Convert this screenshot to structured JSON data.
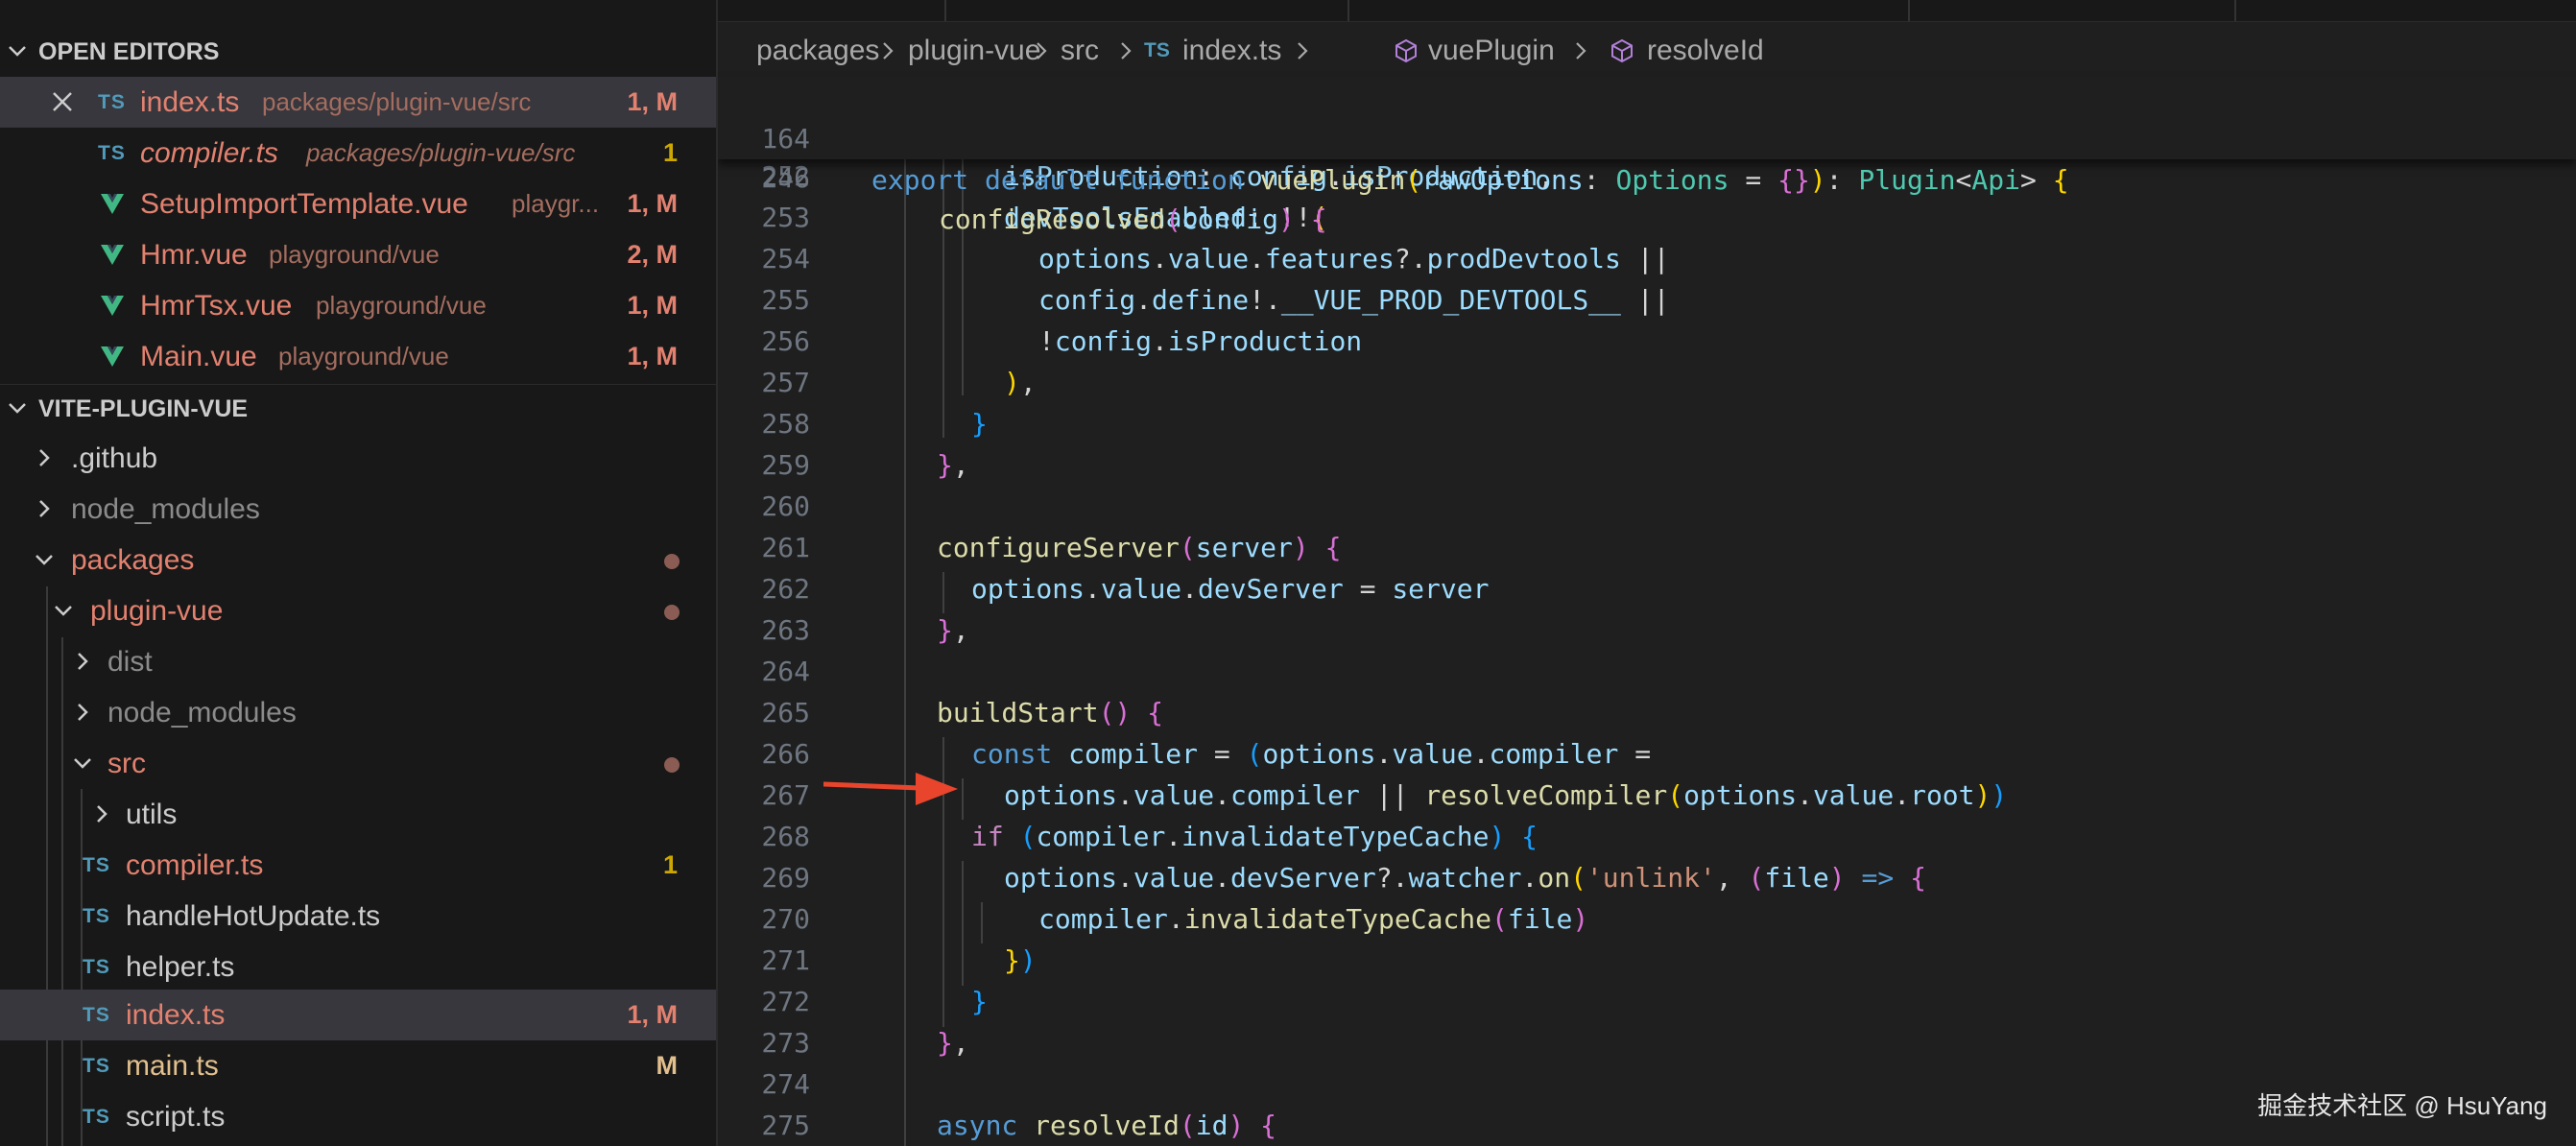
{
  "explorer": {
    "open_editors_title": "OPEN EDITORS",
    "project_title": "VITE-PLUGIN-VUE",
    "ts_badge": "TS",
    "open_editors": [
      {
        "name": "index.ts",
        "path": "packages/plugin-vue/src",
        "status": "1, M",
        "type": "ts"
      },
      {
        "name": "compiler.ts",
        "path": "packages/plugin-vue/src",
        "status": "1",
        "type": "ts"
      },
      {
        "name": "SetupImportTemplate.vue",
        "path": "playgr...",
        "status": "1, M",
        "type": "vue"
      },
      {
        "name": "Hmr.vue",
        "path": "playground/vue",
        "status": "2, M",
        "type": "vue"
      },
      {
        "name": "HmrTsx.vue",
        "path": "playground/vue",
        "status": "1, M",
        "type": "vue"
      },
      {
        "name": "Main.vue",
        "path": "playground/vue",
        "status": "1, M",
        "type": "vue"
      }
    ],
    "tree": [
      {
        "name": ".github"
      },
      {
        "name": "node_modules"
      },
      {
        "name": "packages"
      },
      {
        "name": "plugin-vue"
      },
      {
        "name": "dist"
      },
      {
        "name": "node_modules"
      },
      {
        "name": "src"
      },
      {
        "name": "utils"
      },
      {
        "name": "compiler.ts",
        "status": "1"
      },
      {
        "name": "handleHotUpdate.ts"
      },
      {
        "name": "helper.ts"
      },
      {
        "name": "index.ts",
        "status": "1, M"
      },
      {
        "name": "main.ts",
        "status": "M"
      },
      {
        "name": "script.ts"
      }
    ]
  },
  "breadcrumb": {
    "items": [
      "packages",
      "plugin-vue",
      "src",
      "index.ts",
      "vuePlugin",
      "resolveId"
    ],
    "ts_badge": "TS"
  },
  "editor": {
    "sticky_lines": [
      {
        "num": "164",
        "text": "export default function vuePlugin(rawOptions: Options = {}): Plugin<Api> {"
      },
      {
        "num": "246",
        "text": "configResolved(config) {"
      }
    ],
    "lines": [
      {
        "num": "252",
        "text": "isProduction: config.isProduction,"
      },
      {
        "num": "253",
        "text": "devToolsEnabled: !!("
      },
      {
        "num": "254",
        "text": "options.value.features?.prodDevtools ||"
      },
      {
        "num": "255",
        "text": "config.define!.__VUE_PROD_DEVTOOLS__ ||"
      },
      {
        "num": "256",
        "text": "!config.isProduction"
      },
      {
        "num": "257",
        "text": "),"
      },
      {
        "num": "258",
        "text": "}"
      },
      {
        "num": "259",
        "text": "},"
      },
      {
        "num": "260",
        "text": ""
      },
      {
        "num": "261",
        "text": "configureServer(server) {"
      },
      {
        "num": "262",
        "text": "options.value.devServer = server"
      },
      {
        "num": "263",
        "text": "},"
      },
      {
        "num": "264",
        "text": ""
      },
      {
        "num": "265",
        "text": "buildStart() {"
      },
      {
        "num": "266",
        "text": "const compiler = (options.value.compiler ="
      },
      {
        "num": "267",
        "text": "options.value.compiler || resolveCompiler(options.value.root))"
      },
      {
        "num": "268",
        "text": "if (compiler.invalidateTypeCache) {"
      },
      {
        "num": "269",
        "text": "options.value.devServer?.watcher.on('unlink', (file) => {"
      },
      {
        "num": "270",
        "text": "compiler.invalidateTypeCache(file)"
      },
      {
        "num": "271",
        "text": "})"
      },
      {
        "num": "272",
        "text": "}"
      },
      {
        "num": "273",
        "text": "},"
      },
      {
        "num": "274",
        "text": ""
      },
      {
        "num": "275",
        "text": "async resolveId(id) {"
      }
    ]
  },
  "watermark": "掘金技术社区 @ HsuYang",
  "colors": {
    "sidebar_bg": "#181818",
    "editor_bg": "#1f1f1f",
    "selected_row": "#37373d",
    "modified_text": "#e2816f",
    "arrow": "#e8452c"
  }
}
